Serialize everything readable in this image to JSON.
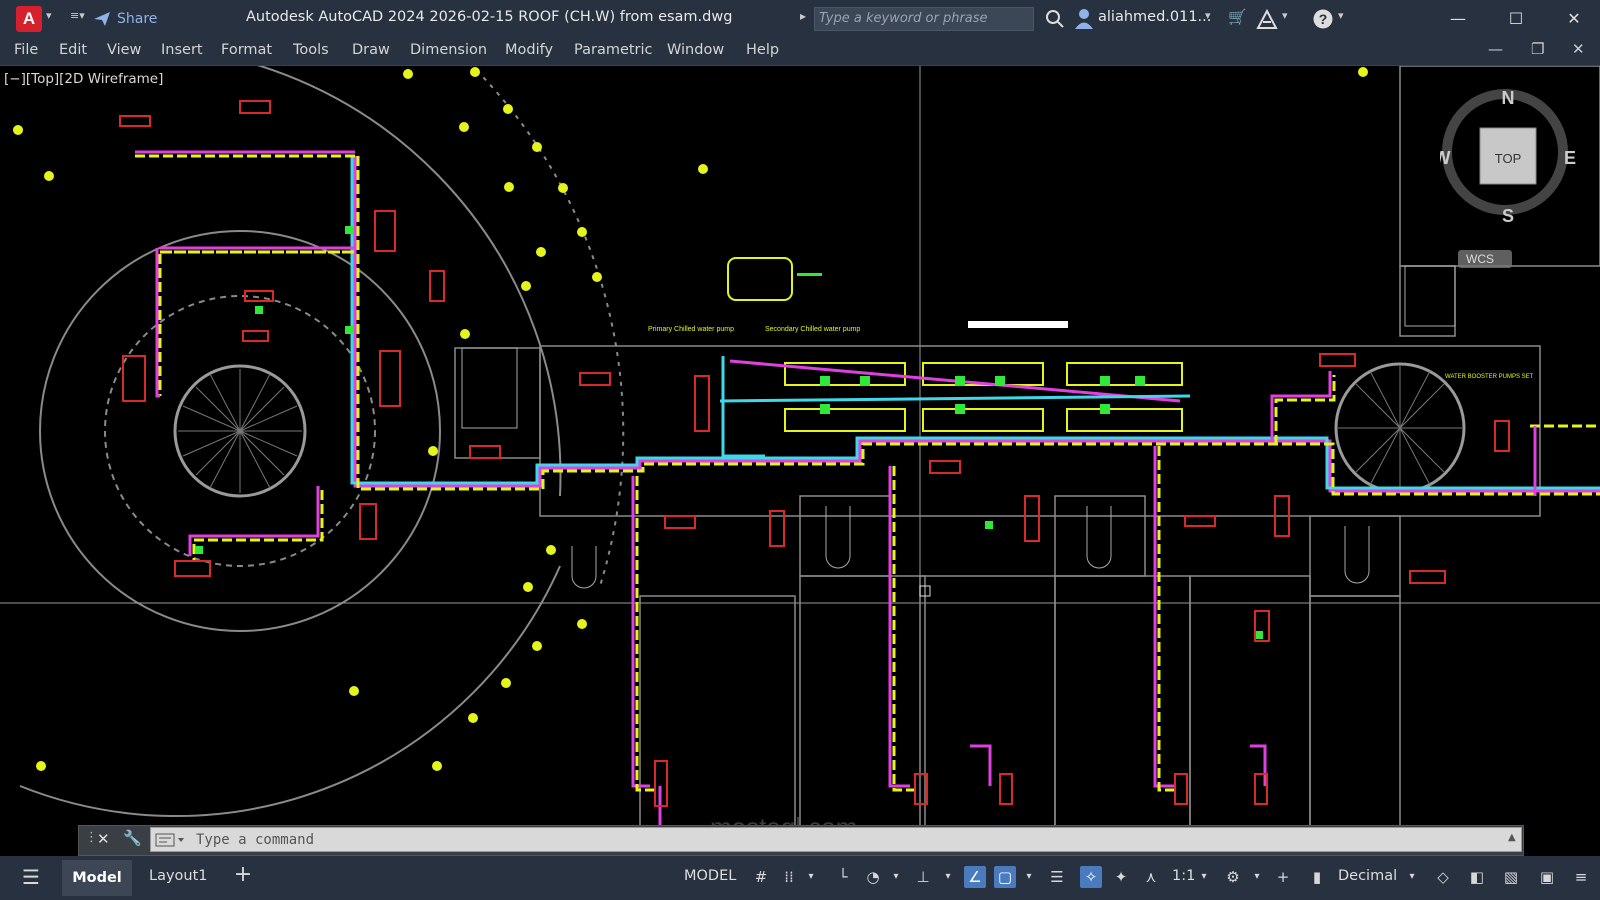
{
  "window": {
    "app_logo": "A",
    "share_label": "Share",
    "title": "Autodesk AutoCAD 2024    2026-02-15 ROOF (CH.W) from esam.dwg",
    "search_placeholder": "Type a keyword or phrase",
    "user": "aliahmed.011...",
    "controls": {
      "minimize": "—",
      "maximize": "☐",
      "close": "✕"
    }
  },
  "menu": {
    "items": [
      "File",
      "Edit",
      "View",
      "Insert",
      "Format",
      "Tools",
      "Draw",
      "Dimension",
      "Modify",
      "Parametric",
      "Window",
      "Help"
    ],
    "doc_controls": {
      "minimize": "—",
      "restore": "❐",
      "close": "✕"
    }
  },
  "viewport": {
    "label": "[−][Top][2D Wireframe]",
    "viewcube": {
      "top": "TOP",
      "north": "N",
      "south": "S",
      "east": "E",
      "west": "W",
      "wcs": "WCS"
    }
  },
  "drawing_notes": {
    "primary_pump": "Primary Chilled water pump",
    "secondary_pump": "Secondary Chilled water pump",
    "booster": "WATER BOOSTER PUMPS SET"
  },
  "command": {
    "placeholder": "Type a command",
    "close": "✕",
    "settings": "🔧"
  },
  "status": {
    "menu": "☰",
    "tabs": [
      "Model",
      "Layout1"
    ],
    "add_tab": "+",
    "model_label": "MODEL",
    "scale": "1:1",
    "units": "Decimal"
  },
  "watermark": "mostaql.com",
  "colors": {
    "chrome": "#27313f",
    "canvas": "#000000",
    "pipe_yellow": "#e5f51c",
    "pipe_magenta": "#e040e0",
    "pipe_cyan": "#3fd8e8",
    "pipe_green": "#2ee83a",
    "equip_red": "#d92a2a",
    "outline_gray": "#8a8a8a"
  }
}
